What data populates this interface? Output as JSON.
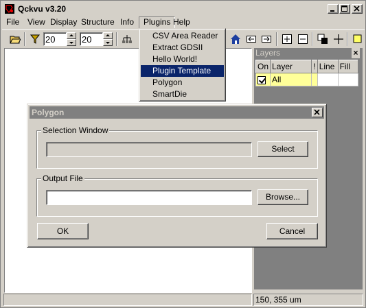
{
  "app": {
    "title": "Qckvu v3.20"
  },
  "menubar": {
    "items": [
      {
        "label": "File"
      },
      {
        "label": "View"
      },
      {
        "label": "Display"
      },
      {
        "label": "Structure"
      },
      {
        "label": "Info"
      },
      {
        "label": "Plugins"
      },
      {
        "label": "Help"
      }
    ]
  },
  "toolbar": {
    "spin1_value": "20",
    "spin2_value": "20",
    "icons": [
      "open-folder-icon",
      "filter-icon",
      "hierarchy-icon",
      "home-icon",
      "arrow-left-icon",
      "arrow-right-icon",
      "zoom-in-icon",
      "zoom-out-icon",
      "layer-shapes-icon",
      "crosshair-icon",
      "select-icon"
    ]
  },
  "plugins_menu": {
    "items": [
      {
        "label": "CSV Area Reader"
      },
      {
        "label": "Extract GDSII"
      },
      {
        "label": "Hello World!"
      },
      {
        "label": "Plugin Template",
        "highlighted": true
      },
      {
        "label": "Polygon"
      },
      {
        "label": "SmartDie"
      }
    ]
  },
  "layers_panel": {
    "title": "Layers",
    "close_label": "×",
    "columns": [
      "On",
      "Layer",
      "!",
      "Line",
      "Fill"
    ],
    "rows": [
      {
        "on": true,
        "layer": "All",
        "line": "",
        "fill": ""
      }
    ],
    "colors": {
      "highlight": "#ffff99"
    }
  },
  "dialog": {
    "title": "Polygon",
    "selection_group_label": "Selection Window",
    "selection_value": "",
    "select_button": "Select",
    "output_group_label": "Output File",
    "output_value": "",
    "browse_button": "Browse...",
    "ok_button": "OK",
    "cancel_button": "Cancel"
  },
  "statusbar": {
    "left": "",
    "coords": "150, 355 um"
  },
  "colors": {
    "face": "#d4d0c8",
    "menu_highlight": "#0a246a",
    "inactive_title": "#808080"
  }
}
